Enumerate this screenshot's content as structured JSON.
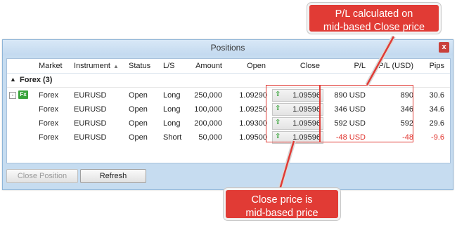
{
  "window": {
    "title": "Positions"
  },
  "columns": {
    "market": "Market",
    "instrument": "Instrument",
    "status": "Status",
    "ls": "L/S",
    "amount": "Amount",
    "open": "Open",
    "close": "Close",
    "pl": "P/L",
    "pl_usd": "P/L (USD)",
    "pips": "Pips"
  },
  "group": {
    "label": "Forex (3)",
    "icon": "fx-icon",
    "icon_text": "Fx"
  },
  "rows": [
    {
      "market": "Forex",
      "instrument": "EURUSD",
      "status": "Open",
      "ls": "Long",
      "amount": "250,000",
      "open": "1.09290",
      "close": "1.09596",
      "pl": "890 USD",
      "pl_usd": "890",
      "pips": "30.6",
      "negative": false
    },
    {
      "market": "Forex",
      "instrument": "EURUSD",
      "status": "Open",
      "ls": "Long",
      "amount": "100,000",
      "open": "1.09250",
      "close": "1.09596",
      "pl": "346 USD",
      "pl_usd": "346",
      "pips": "34.6",
      "negative": false
    },
    {
      "market": "Forex",
      "instrument": "EURUSD",
      "status": "Open",
      "ls": "Long",
      "amount": "200,000",
      "open": "1.09300",
      "close": "1.09596",
      "pl": "592 USD",
      "pl_usd": "592",
      "pips": "29.6",
      "negative": false
    },
    {
      "market": "Forex",
      "instrument": "EURUSD",
      "status": "Open",
      "ls": "Short",
      "amount": "50,000",
      "open": "1.09500",
      "close": "1.09596",
      "pl": "-48 USD",
      "pl_usd": "-48",
      "pips": "-9.6",
      "negative": true
    }
  ],
  "footer": {
    "close_position": "Close Position",
    "refresh": "Refresh"
  },
  "callouts": {
    "top_line1": "P/L calculated on",
    "top_line2": "mid-based Close price",
    "bottom_line1": "Close price is",
    "bottom_line2": "mid-based price"
  },
  "colors": {
    "accent": "#e13b35",
    "negative": "#e0322c",
    "fx_badge": "#3aa43c"
  }
}
